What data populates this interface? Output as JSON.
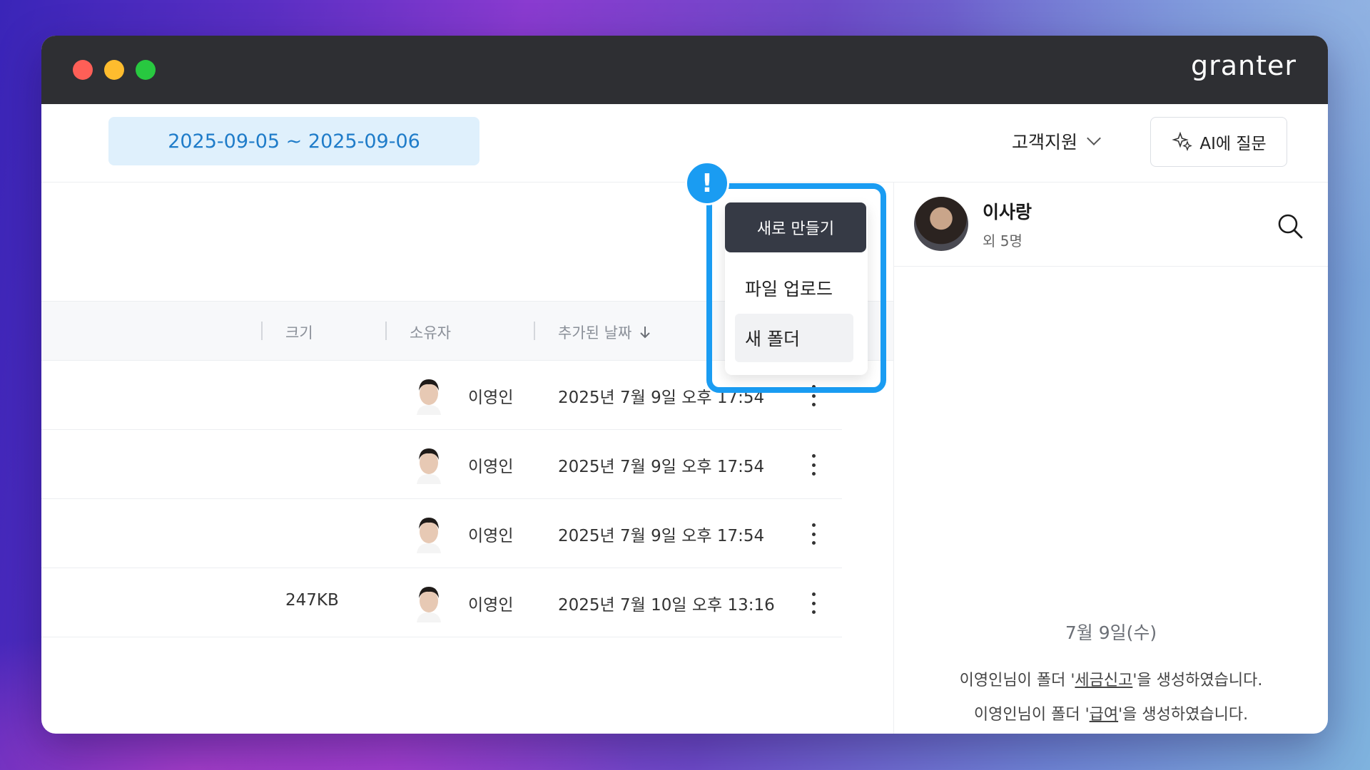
{
  "app": {
    "brand": "granter"
  },
  "toolbar": {
    "date_range": "2025-09-05 ~ 2025-09-06",
    "support_label": "고객지원",
    "ai_label": "AI에 질문"
  },
  "table": {
    "columns": {
      "size": "크기",
      "owner": "소유자",
      "date_added": "추가된 날짜"
    },
    "rows": [
      {
        "size": "",
        "owner": "이영인",
        "date": "2025년 7월 9일 오후 17:54"
      },
      {
        "size": "",
        "owner": "이영인",
        "date": "2025년 7월 9일 오후 17:54"
      },
      {
        "size": "",
        "owner": "이영인",
        "date": "2025년 7월 9일 오후 17:54"
      },
      {
        "size": "247KB",
        "owner": "이영인",
        "date": "2025년 7월 10일 오후 13:16"
      }
    ]
  },
  "menu": {
    "new_label": "새로 만들기",
    "items": [
      "파일 업로드",
      "새 폴더"
    ],
    "badge": "!"
  },
  "panel": {
    "name": "이사랑",
    "sub": "외 5명",
    "date": "7월 9일(수)",
    "activities": [
      {
        "pre": "이영인님이 폴더 '",
        "link": "세금신고",
        "post": "'을 생성하였습니다."
      },
      {
        "pre": "이영인님이 폴더 '",
        "link": "급여",
        "post": "'을 생성하였습니다."
      }
    ]
  },
  "colors": {
    "accent": "#1a9cf2",
    "titlebar": "#2e2f33",
    "date_text": "#1f7cc9"
  }
}
